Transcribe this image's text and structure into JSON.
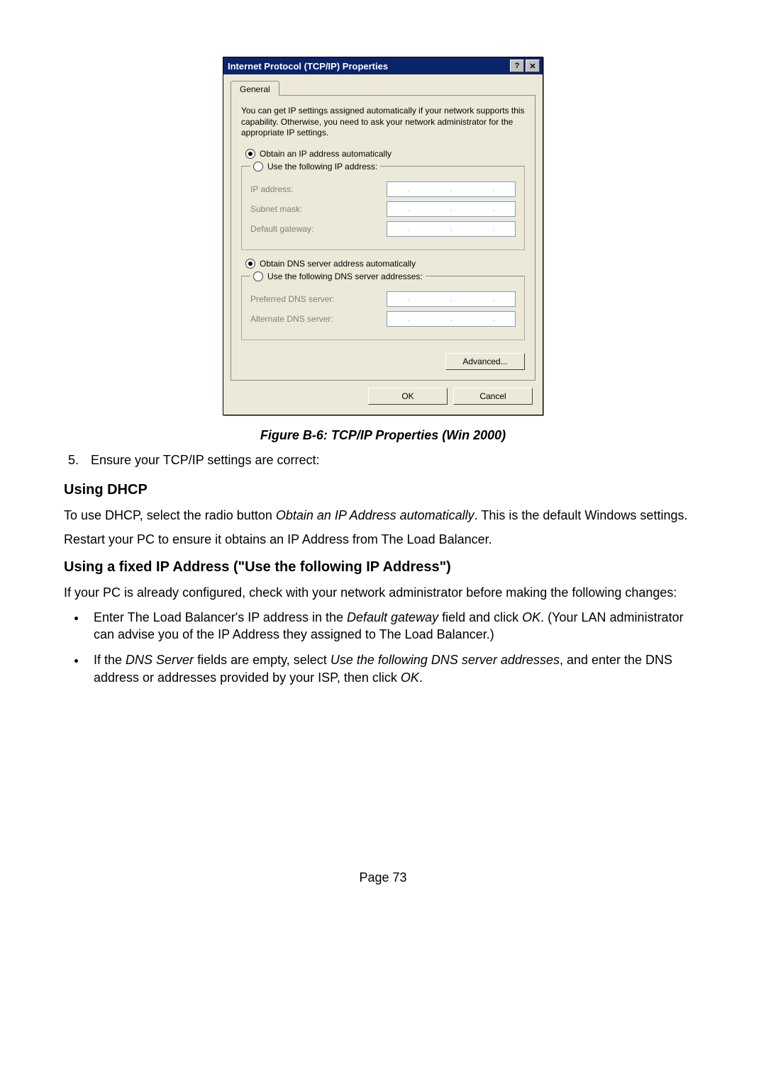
{
  "dialog": {
    "title": "Internet Protocol (TCP/IP) Properties",
    "help": "?",
    "close": "✕",
    "tab": "General",
    "intro": "You can get IP settings assigned automatically if your network supports this capability. Otherwise, you need to ask your network administrator for the appropriate IP settings.",
    "radio1": "Obtain an IP address automatically",
    "radio2": "Use the following IP address:",
    "ipaddr": "IP address:",
    "subnet": "Subnet mask:",
    "gateway": "Default gateway:",
    "radio3": "Obtain DNS server address automatically",
    "radio4": "Use the following DNS server addresses:",
    "pref_dns": "Preferred DNS server:",
    "alt_dns": "Alternate DNS server:",
    "advanced": "Advanced...",
    "ok": "OK",
    "cancel": "Cancel"
  },
  "caption": "Figure B-6: TCP/IP Properties (Win 2000)",
  "list_start": 5,
  "list_item": "Ensure your TCP/IP settings are correct:",
  "heading1": "Using DHCP",
  "p1a": "To use DHCP, select the radio button ",
  "p1b": "Obtain an IP Address automatically",
  "p1c": ". This is the default Windows settings.",
  "p2": "Restart your PC to ensure it obtains an IP Address from The Load Balancer.",
  "heading2": "Using a fixed IP Address (\"Use the following IP Address\")",
  "p3": "If your PC is already configured, check with your network administrator before making the following changes:",
  "b1a": "Enter The Load Balancer's IP address in the ",
  "b1b": "Default gateway",
  "b1c": " field and click ",
  "b1d": "OK",
  "b1e": ". (Your LAN administrator can advise you of the IP Address they assigned to The Load Balancer.)",
  "b2a": "If the ",
  "b2b": "DNS Server",
  "b2c": " fields are empty, select ",
  "b2d": "Use the following DNS server addresses",
  "b2e": ", and enter the DNS address or addresses provided by your ISP, then click ",
  "b2f": "OK",
  "b2g": ".",
  "footer": "Page 73"
}
